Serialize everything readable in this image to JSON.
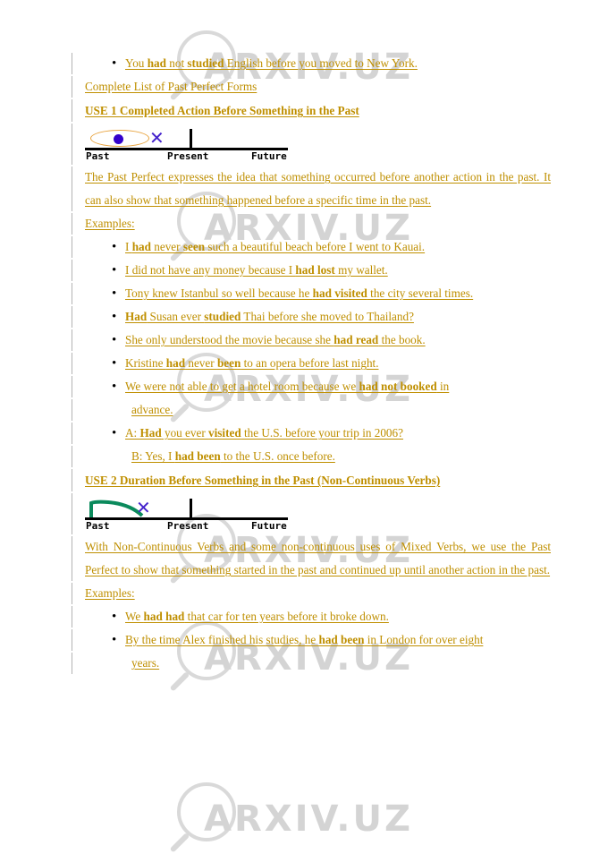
{
  "document": {
    "watermark": {
      "text": "ARXIV.UZ",
      "color": "#d4d4d4"
    },
    "text_color": "#bf8f00",
    "blocks": [
      {
        "type": "bullet",
        "name": "bullet-you-had-not-studied",
        "lines": [
          [
            {
              "t": "You ",
              "b": false
            },
            {
              "t": "had",
              "b": true
            },
            {
              "t": " not ",
              "b": false
            },
            {
              "t": "studied",
              "b": true
            },
            {
              "t": " English before you moved to New York.",
              "b": false
            }
          ]
        ]
      },
      {
        "type": "plain",
        "name": "complete-list-link",
        "lines": [
          [
            {
              "t": "Complete List of Past Perfect Forms",
              "b": false
            }
          ]
        ]
      },
      {
        "type": "heading",
        "name": "heading-use-1",
        "lines": [
          [
            {
              "t": "USE 1 Completed Action Before Something in the Past",
              "b": true
            }
          ]
        ]
      },
      {
        "type": "timeline",
        "name": "timeline-use-1",
        "variant": "ellipse-dot",
        "labels": {
          "past": "Past",
          "present": "Present",
          "future": "Future"
        },
        "marker_colors": {
          "ellipse": "#e8a33d",
          "dot": "#3300cc",
          "x": "#4422cc"
        }
      },
      {
        "type": "para",
        "name": "paragraph-use-1-description",
        "lines": [
          [
            {
              "t": "The Past Perfect expresses the idea that something occurred before another action in the past. It can also show that something happened before a specific time in the past.",
              "b": false
            }
          ]
        ]
      },
      {
        "type": "plain",
        "name": "examples-label-use-1",
        "lines": [
          [
            {
              "t": "Examples:",
              "b": false
            }
          ]
        ]
      },
      {
        "type": "bullet",
        "name": "bullet-i-had-never-seen",
        "lines": [
          [
            {
              "t": "I ",
              "b": false
            },
            {
              "t": "had",
              "b": true
            },
            {
              "t": " never ",
              "b": false
            },
            {
              "t": "seen",
              "b": true
            },
            {
              "t": " such a beautiful beach before I went to Kauai.",
              "b": false
            }
          ]
        ]
      },
      {
        "type": "bullet",
        "name": "bullet-i-did-not-have-any-money",
        "lines": [
          [
            {
              "t": "I did not have any money because I ",
              "b": false
            },
            {
              "t": "had lost",
              "b": true
            },
            {
              "t": " my wallet.",
              "b": false
            }
          ]
        ]
      },
      {
        "type": "bullet",
        "name": "bullet-tony-knew-istanbul",
        "lines": [
          [
            {
              "t": "Tony knew Istanbul so well because he ",
              "b": false
            },
            {
              "t": "had visited",
              "b": true
            },
            {
              "t": " the city several times.",
              "b": false
            }
          ]
        ]
      },
      {
        "type": "bullet",
        "name": "bullet-had-susan-ever-studied",
        "lines": [
          [
            {
              "t": "Had",
              "b": true
            },
            {
              "t": " Susan ever ",
              "b": false
            },
            {
              "t": "studied",
              "b": true
            },
            {
              "t": " Thai before she moved to Thailand?",
              "b": false
            }
          ]
        ]
      },
      {
        "type": "bullet",
        "name": "bullet-she-only-understood",
        "lines": [
          [
            {
              "t": "She only understood the movie because she ",
              "b": false
            },
            {
              "t": "had read",
              "b": true
            },
            {
              "t": " the book.",
              "b": false
            }
          ]
        ]
      },
      {
        "type": "bullet",
        "name": "bullet-kristine-had-never-been",
        "lines": [
          [
            {
              "t": "Kristine ",
              "b": false
            },
            {
              "t": "had",
              "b": true
            },
            {
              "t": " never ",
              "b": false
            },
            {
              "t": "been",
              "b": true
            },
            {
              "t": " to an opera before last night.",
              "b": false
            }
          ]
        ]
      },
      {
        "type": "bullet",
        "name": "bullet-we-were-not-able-hotel",
        "lines": [
          [
            {
              "t": "We were not able to get a hotel room because we ",
              "b": false
            },
            {
              "t": "had not booked",
              "b": true
            },
            {
              "t": " in",
              "b": false
            }
          ],
          [
            {
              "t": "advance.",
              "b": false
            }
          ]
        ]
      },
      {
        "type": "bullet",
        "name": "bullet-dialogue-had-you-ever-visited",
        "lines": [
          [
            {
              "t": "A: ",
              "b": false
            },
            {
              "t": "Had",
              "b": true
            },
            {
              "t": " you ever ",
              "b": false
            },
            {
              "t": "visited",
              "b": true
            },
            {
              "t": " the U.S. before your trip in 2006?",
              "b": false
            }
          ],
          [
            {
              "t": "B: Yes, I ",
              "b": false
            },
            {
              "t": "had been",
              "b": true
            },
            {
              "t": " to the U.S. once before.",
              "b": false
            }
          ]
        ]
      },
      {
        "type": "heading",
        "name": "heading-use-2",
        "lines": [
          [
            {
              "t": "USE 2 Duration Before Something in the Past (Non-Continuous Verbs)",
              "b": true
            }
          ]
        ]
      },
      {
        "type": "timeline",
        "name": "timeline-use-2",
        "variant": "curve",
        "labels": {
          "past": "Past",
          "present": "Present",
          "future": "Future"
        },
        "marker_colors": {
          "curve": "#0b8a5c",
          "x": "#4422cc"
        }
      },
      {
        "type": "para",
        "name": "paragraph-use-2-description",
        "lines": [
          [
            {
              "t": "With Non-Continuous Verbs and some non-continuous uses of Mixed Verbs, we use the Past Perfect to show that something started in the past and continued up until another action in the past.",
              "b": false
            }
          ]
        ]
      },
      {
        "type": "plain",
        "name": "examples-label-use-2",
        "lines": [
          [
            {
              "t": "Examples:",
              "b": false
            }
          ]
        ]
      },
      {
        "type": "bullet",
        "name": "bullet-we-had-had-that-car",
        "lines": [
          [
            {
              "t": "We ",
              "b": false
            },
            {
              "t": "had had",
              "b": true
            },
            {
              "t": " that car for ten years before it broke down.",
              "b": false
            }
          ]
        ]
      },
      {
        "type": "bullet",
        "name": "bullet-by-the-time-alex",
        "lines": [
          [
            {
              "t": "By the time Alex finished his studies, he ",
              "b": false
            },
            {
              "t": "had been",
              "b": true
            },
            {
              "t": " in London for over eight",
              "b": false
            }
          ],
          [
            {
              "t": "years.",
              "b": false
            }
          ]
        ]
      }
    ]
  }
}
